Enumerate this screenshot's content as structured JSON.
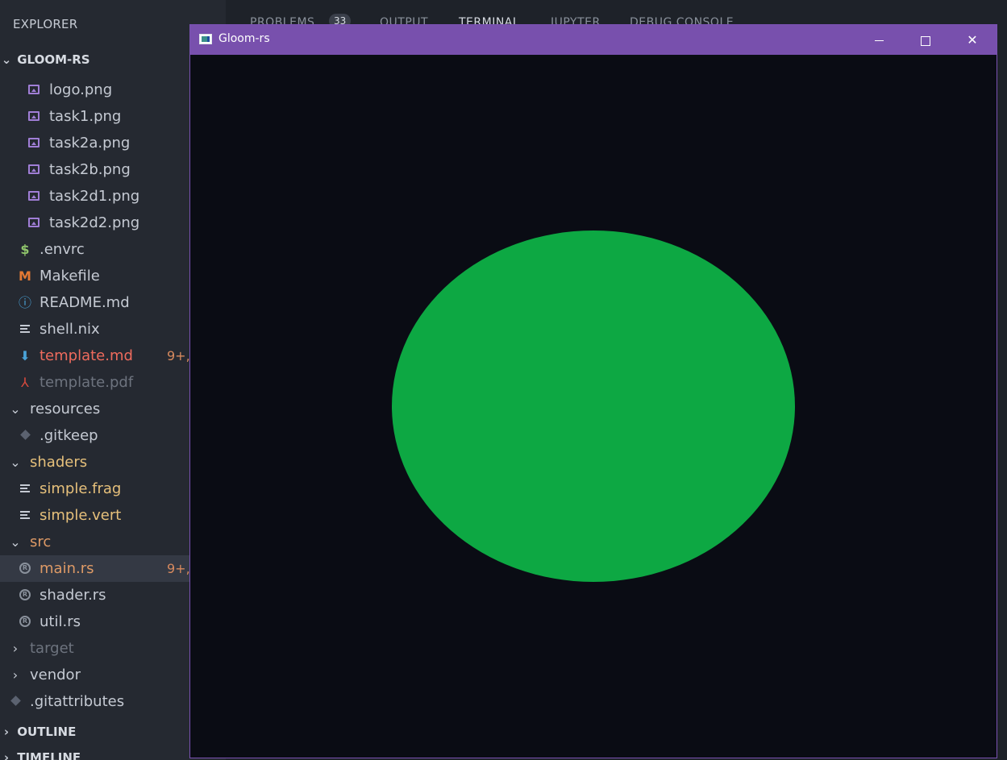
{
  "sidebar": {
    "title": "EXPLORER",
    "more": "...",
    "project": "GLOOM-RS",
    "items": [
      {
        "label": "logo.png",
        "icon": "image-icon",
        "depth": 2,
        "color": "default"
      },
      {
        "label": "task1.png",
        "icon": "image-icon",
        "depth": 2,
        "color": "default"
      },
      {
        "label": "task2a.png",
        "icon": "image-icon",
        "depth": 2,
        "color": "default"
      },
      {
        "label": "task2b.png",
        "icon": "image-icon",
        "depth": 2,
        "color": "default"
      },
      {
        "label": "task2d1.png",
        "icon": "image-icon",
        "depth": 2,
        "color": "default"
      },
      {
        "label": "task2d2.png",
        "icon": "image-icon",
        "depth": 2,
        "color": "default"
      },
      {
        "label": ".envrc",
        "icon": "dollar-icon",
        "depth": 1,
        "color": "default"
      },
      {
        "label": "Makefile",
        "icon": "makefile-icon",
        "depth": 1,
        "color": "default"
      },
      {
        "label": "README.md",
        "icon": "info-icon",
        "depth": 1,
        "color": "default"
      },
      {
        "label": "shell.nix",
        "icon": "text-lines-icon",
        "depth": 1,
        "color": "default"
      },
      {
        "label": "template.md",
        "icon": "markdown-arrow-icon",
        "depth": 1,
        "color": "red",
        "badge": "9+,"
      },
      {
        "label": "template.pdf",
        "icon": "pdf-icon",
        "depth": 1,
        "color": "dim"
      },
      {
        "label": "resources",
        "icon": "chevron-down-icon",
        "depth": 0,
        "color": "default"
      },
      {
        "label": ".gitkeep",
        "icon": "git-icon",
        "depth": 1,
        "color": "default"
      },
      {
        "label": "shaders",
        "icon": "chevron-down-icon",
        "depth": 0,
        "color": "yellow"
      },
      {
        "label": "simple.frag",
        "icon": "text-lines-icon",
        "depth": 1,
        "color": "yellow"
      },
      {
        "label": "simple.vert",
        "icon": "text-lines-icon",
        "depth": 1,
        "color": "yellow"
      },
      {
        "label": "src",
        "icon": "chevron-down-icon",
        "depth": 0,
        "color": "orange"
      },
      {
        "label": "main.rs",
        "icon": "rust-icon",
        "depth": 1,
        "color": "orange",
        "badge": "9+,",
        "selected": true
      },
      {
        "label": "shader.rs",
        "icon": "rust-icon",
        "depth": 1,
        "color": "default"
      },
      {
        "label": "util.rs",
        "icon": "rust-icon",
        "depth": 1,
        "color": "default"
      },
      {
        "label": "target",
        "icon": "chevron-right-icon",
        "depth": 0,
        "color": "dim"
      },
      {
        "label": "vendor",
        "icon": "chevron-right-icon",
        "depth": 0,
        "color": "default"
      },
      {
        "label": ".gitattributes",
        "icon": "git-icon",
        "depth": 0,
        "color": "default"
      }
    ],
    "outline": "OUTLINE",
    "timeline": "TIMELINE"
  },
  "panel": {
    "tabs": [
      "PROBLEMS",
      "OUTPUT",
      "TERMINAL",
      "JUPYTER",
      "DEBUG CONSOLE"
    ],
    "problems_count": "33",
    "active_tab": "TERMINAL"
  },
  "window": {
    "title": "Gloom-rs",
    "titlebar_color": "#7850ad",
    "canvas_color": "#0a0c14",
    "shape_color": "#0da843",
    "shape": "ellipse"
  }
}
